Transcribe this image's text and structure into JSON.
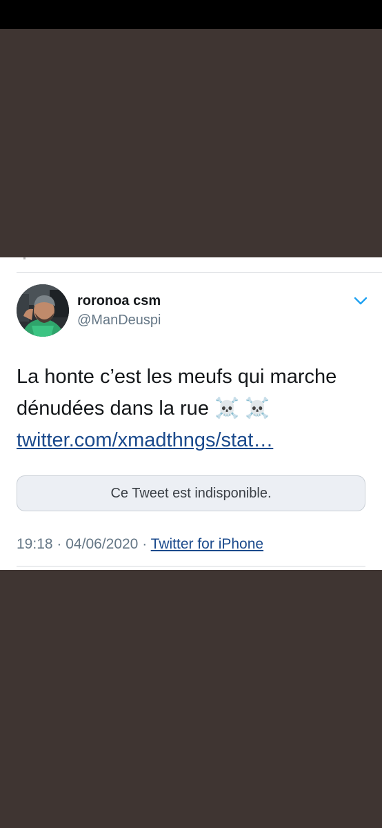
{
  "tweet": {
    "display_name": "roronoa csm",
    "handle": "@ManDeuspi",
    "text_line1": "La honte c’est les meufs qui marche",
    "text_line2": "dénudées dans la rue",
    "emoji": "☠️ ☠️",
    "link_text": "twitter.com/xmadthngs/stat…",
    "quoted_unavailable": "Ce Tweet est indisponible.",
    "time": "19:18",
    "date": "04/06/2020",
    "separator": "·",
    "source": "Twitter for iPhone"
  },
  "icons": {
    "avatar": "profile-photo",
    "chevron": "chevron-down-icon"
  },
  "colors": {
    "background": "#3f3532",
    "card": "#ffffff",
    "link": "#1b4a8c",
    "secondary_text": "#657786",
    "chevron": "#1da1f2"
  }
}
